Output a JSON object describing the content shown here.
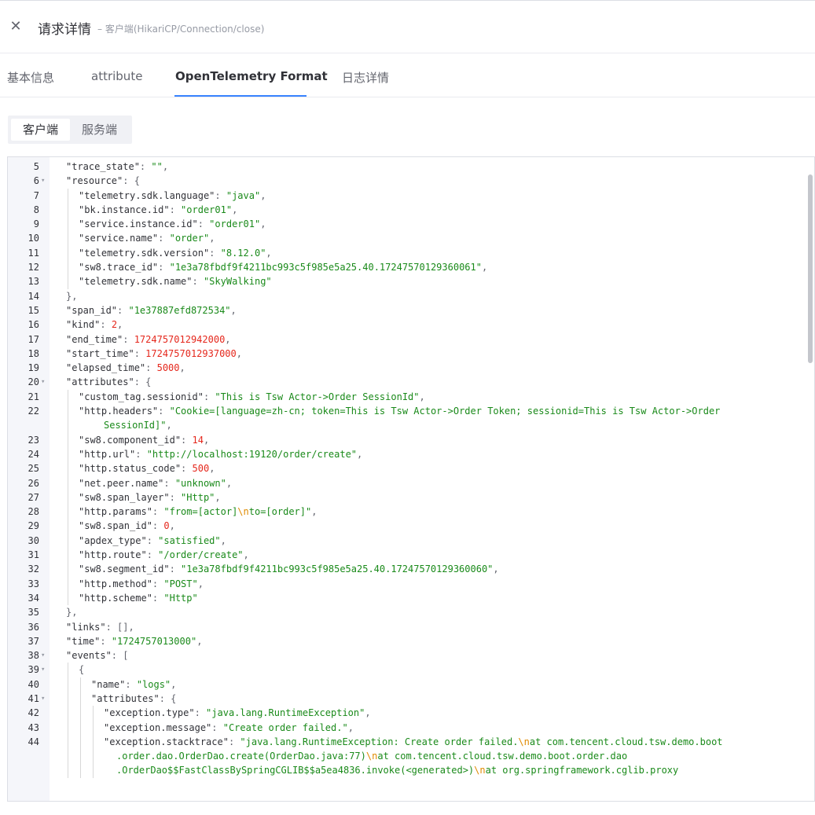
{
  "header": {
    "title": "请求详情",
    "subtitle": "– 客户端(HikariCP/Connection/close)"
  },
  "tabs": [
    {
      "label": "基本信息"
    },
    {
      "label": "attribute"
    },
    {
      "label": "OpenTelemetry Format"
    },
    {
      "label": "日志详情"
    }
  ],
  "switch": [
    {
      "label": "客户端"
    },
    {
      "label": "服务端"
    }
  ],
  "code_lines": [
    {
      "n": "5",
      "t": [
        [
          "k",
          "\"trace_state\""
        ],
        [
          "p",
          ": "
        ],
        [
          "s",
          "\"\""
        ],
        [
          "p",
          ","
        ]
      ]
    },
    {
      "n": "6",
      "fold": true,
      "t": [
        [
          "k",
          "\"resource\""
        ],
        [
          "p",
          ": {"
        ]
      ]
    },
    {
      "n": "7",
      "i": 1,
      "t": [
        [
          "k",
          "\"telemetry.sdk.language\""
        ],
        [
          "p",
          ": "
        ],
        [
          "s",
          "\"java\""
        ],
        [
          "p",
          ","
        ]
      ]
    },
    {
      "n": "8",
      "i": 1,
      "t": [
        [
          "k",
          "\"bk.instance.id\""
        ],
        [
          "p",
          ": "
        ],
        [
          "s",
          "\"order01\""
        ],
        [
          "p",
          ","
        ]
      ]
    },
    {
      "n": "9",
      "i": 1,
      "t": [
        [
          "k",
          "\"service.instance.id\""
        ],
        [
          "p",
          ": "
        ],
        [
          "s",
          "\"order01\""
        ],
        [
          "p",
          ","
        ]
      ]
    },
    {
      "n": "10",
      "i": 1,
      "t": [
        [
          "k",
          "\"service.name\""
        ],
        [
          "p",
          ": "
        ],
        [
          "s",
          "\"order\""
        ],
        [
          "p",
          ","
        ]
      ]
    },
    {
      "n": "11",
      "i": 1,
      "t": [
        [
          "k",
          "\"telemetry.sdk.version\""
        ],
        [
          "p",
          ": "
        ],
        [
          "s",
          "\"8.12.0\""
        ],
        [
          "p",
          ","
        ]
      ]
    },
    {
      "n": "12",
      "i": 1,
      "t": [
        [
          "k",
          "\"sw8.trace_id\""
        ],
        [
          "p",
          ": "
        ],
        [
          "s",
          "\"1e3a78fbdf9f4211bc993c5f985e5a25.40.17247570129360061\""
        ],
        [
          "p",
          ","
        ]
      ]
    },
    {
      "n": "13",
      "i": 1,
      "t": [
        [
          "k",
          "\"telemetry.sdk.name\""
        ],
        [
          "p",
          ": "
        ],
        [
          "s",
          "\"SkyWalking\""
        ]
      ]
    },
    {
      "n": "14",
      "t": [
        [
          "p",
          "},"
        ]
      ]
    },
    {
      "n": "15",
      "t": [
        [
          "k",
          "\"span_id\""
        ],
        [
          "p",
          ": "
        ],
        [
          "s",
          "\"1e37887efd872534\""
        ],
        [
          "p",
          ","
        ]
      ]
    },
    {
      "n": "16",
      "t": [
        [
          "k",
          "\"kind\""
        ],
        [
          "p",
          ": "
        ],
        [
          "n",
          "2"
        ],
        [
          "p",
          ","
        ]
      ]
    },
    {
      "n": "17",
      "t": [
        [
          "k",
          "\"end_time\""
        ],
        [
          "p",
          ": "
        ],
        [
          "n",
          "1724757012942000"
        ],
        [
          "p",
          ","
        ]
      ]
    },
    {
      "n": "18",
      "t": [
        [
          "k",
          "\"start_time\""
        ],
        [
          "p",
          ": "
        ],
        [
          "n",
          "1724757012937000"
        ],
        [
          "p",
          ","
        ]
      ]
    },
    {
      "n": "19",
      "t": [
        [
          "k",
          "\"elapsed_time\""
        ],
        [
          "p",
          ": "
        ],
        [
          "n",
          "5000"
        ],
        [
          "p",
          ","
        ]
      ]
    },
    {
      "n": "20",
      "fold": true,
      "t": [
        [
          "k",
          "\"attributes\""
        ],
        [
          "p",
          ": {"
        ]
      ]
    },
    {
      "n": "21",
      "i": 1,
      "t": [
        [
          "k",
          "\"custom_tag.sessionid\""
        ],
        [
          "p",
          ": "
        ],
        [
          "s",
          "\"This is Tsw Actor->Order SessionId\""
        ],
        [
          "p",
          ","
        ]
      ]
    },
    {
      "n": "22",
      "i": 1,
      "t": [
        [
          "k",
          "\"http.headers\""
        ],
        [
          "p",
          ": "
        ],
        [
          "s",
          "\"Cookie=[language=zh-cn; token=This is Tsw Actor->Order Token; sessionid=This is Tsw Actor->Order"
        ]
      ]
    },
    {
      "n": "",
      "i": 1,
      "w": 2,
      "t": [
        [
          "s",
          "SessionId]\""
        ],
        [
          "p",
          ","
        ]
      ]
    },
    {
      "n": "23",
      "i": 1,
      "t": [
        [
          "k",
          "\"sw8.component_id\""
        ],
        [
          "p",
          ": "
        ],
        [
          "n",
          "14"
        ],
        [
          "p",
          ","
        ]
      ]
    },
    {
      "n": "24",
      "i": 1,
      "t": [
        [
          "k",
          "\"http.url\""
        ],
        [
          "p",
          ": "
        ],
        [
          "s",
          "\"http://localhost:19120/order/create\""
        ],
        [
          "p",
          ","
        ]
      ]
    },
    {
      "n": "25",
      "i": 1,
      "t": [
        [
          "k",
          "\"http.status_code\""
        ],
        [
          "p",
          ": "
        ],
        [
          "n",
          "500"
        ],
        [
          "p",
          ","
        ]
      ]
    },
    {
      "n": "26",
      "i": 1,
      "t": [
        [
          "k",
          "\"net.peer.name\""
        ],
        [
          "p",
          ": "
        ],
        [
          "s",
          "\"unknown\""
        ],
        [
          "p",
          ","
        ]
      ]
    },
    {
      "n": "27",
      "i": 1,
      "t": [
        [
          "k",
          "\"sw8.span_layer\""
        ],
        [
          "p",
          ": "
        ],
        [
          "s",
          "\"Http\""
        ],
        [
          "p",
          ","
        ]
      ]
    },
    {
      "n": "28",
      "i": 1,
      "t": [
        [
          "k",
          "\"http.params\""
        ],
        [
          "p",
          ": "
        ],
        [
          "s",
          "\"from=[actor]"
        ],
        [
          "e",
          "\\n"
        ],
        [
          "s",
          "to=[order]\""
        ],
        [
          "p",
          ","
        ]
      ]
    },
    {
      "n": "29",
      "i": 1,
      "t": [
        [
          "k",
          "\"sw8.span_id\""
        ],
        [
          "p",
          ": "
        ],
        [
          "n",
          "0"
        ],
        [
          "p",
          ","
        ]
      ]
    },
    {
      "n": "30",
      "i": 1,
      "t": [
        [
          "k",
          "\"apdex_type\""
        ],
        [
          "p",
          ": "
        ],
        [
          "s",
          "\"satisfied\""
        ],
        [
          "p",
          ","
        ]
      ]
    },
    {
      "n": "31",
      "i": 1,
      "t": [
        [
          "k",
          "\"http.route\""
        ],
        [
          "p",
          ": "
        ],
        [
          "s",
          "\"/order/create\""
        ],
        [
          "p",
          ","
        ]
      ]
    },
    {
      "n": "32",
      "i": 1,
      "t": [
        [
          "k",
          "\"sw8.segment_id\""
        ],
        [
          "p",
          ": "
        ],
        [
          "s",
          "\"1e3a78fbdf9f4211bc993c5f985e5a25.40.17247570129360060\""
        ],
        [
          "p",
          ","
        ]
      ]
    },
    {
      "n": "33",
      "i": 1,
      "t": [
        [
          "k",
          "\"http.method\""
        ],
        [
          "p",
          ": "
        ],
        [
          "s",
          "\"POST\""
        ],
        [
          "p",
          ","
        ]
      ]
    },
    {
      "n": "34",
      "i": 1,
      "t": [
        [
          "k",
          "\"http.scheme\""
        ],
        [
          "p",
          ": "
        ],
        [
          "s",
          "\"Http\""
        ]
      ]
    },
    {
      "n": "35",
      "t": [
        [
          "p",
          "},"
        ]
      ]
    },
    {
      "n": "36",
      "t": [
        [
          "k",
          "\"links\""
        ],
        [
          "p",
          ": [],"
        ]
      ]
    },
    {
      "n": "37",
      "t": [
        [
          "k",
          "\"time\""
        ],
        [
          "p",
          ": "
        ],
        [
          "s",
          "\"1724757013000\""
        ],
        [
          "p",
          ","
        ]
      ]
    },
    {
      "n": "38",
      "fold": true,
      "t": [
        [
          "k",
          "\"events\""
        ],
        [
          "p",
          ": ["
        ]
      ]
    },
    {
      "n": "39",
      "fold": true,
      "i": 1,
      "t": [
        [
          "p",
          "{"
        ]
      ]
    },
    {
      "n": "40",
      "i": 2,
      "t": [
        [
          "k",
          "\"name\""
        ],
        [
          "p",
          ": "
        ],
        [
          "s",
          "\"logs\""
        ],
        [
          "p",
          ","
        ]
      ]
    },
    {
      "n": "41",
      "fold": true,
      "i": 2,
      "t": [
        [
          "k",
          "\"attributes\""
        ],
        [
          "p",
          ": {"
        ]
      ]
    },
    {
      "n": "42",
      "i": 3,
      "t": [
        [
          "k",
          "\"exception.type\""
        ],
        [
          "p",
          ": "
        ],
        [
          "s",
          "\"java.lang.RuntimeException\""
        ],
        [
          "p",
          ","
        ]
      ]
    },
    {
      "n": "43",
      "i": 3,
      "t": [
        [
          "k",
          "\"exception.message\""
        ],
        [
          "p",
          ": "
        ],
        [
          "s",
          "\"Create order failed.\""
        ],
        [
          "p",
          ","
        ]
      ]
    },
    {
      "n": "44",
      "i": 3,
      "t": [
        [
          "k",
          "\"exception.stacktrace\""
        ],
        [
          "p",
          ": "
        ],
        [
          "s",
          "\"java.lang.RuntimeException: Create order failed."
        ],
        [
          "e",
          "\\n"
        ],
        [
          "s",
          "at com.tencent.cloud.tsw.demo.boot"
        ]
      ]
    },
    {
      "n": "",
      "i": 3,
      "w": 1,
      "t": [
        [
          "s",
          ".order.dao.OrderDao.create(OrderDao.java:77)"
        ],
        [
          "e",
          "\\n"
        ],
        [
          "s",
          "at com.tencent.cloud.tsw.demo.boot.order.dao"
        ]
      ]
    },
    {
      "n": "",
      "i": 3,
      "w": 1,
      "t": [
        [
          "s",
          ".OrderDao$$FastClassBySpringCGLIB$$a5ea4836.invoke(<generated>)"
        ],
        [
          "e",
          "\\n"
        ],
        [
          "s",
          "at org.springframework.cglib.proxy"
        ]
      ]
    }
  ]
}
